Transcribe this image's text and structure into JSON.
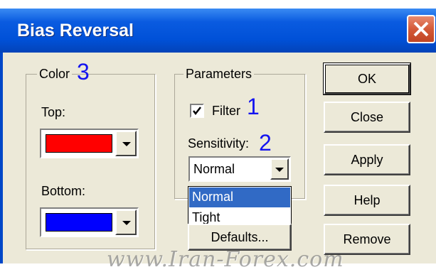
{
  "window": {
    "title": "Bias Reversal"
  },
  "color_group": {
    "legend": "Color",
    "annotation": "3",
    "top_label": "Top:",
    "top_color": "#ff0000",
    "bottom_label": "Bottom:",
    "bottom_color": "#0000ff"
  },
  "parameters_group": {
    "legend": "Parameters",
    "filter_label": "Filter",
    "filter_checked": true,
    "filter_annotation": "1",
    "sensitivity_label": "Sensitivity:",
    "sensitivity_annotation": "2",
    "sensitivity_value": "Normal",
    "sensitivity_options": [
      "Normal",
      "Tight"
    ],
    "defaults_label": "Defaults..."
  },
  "buttons": {
    "ok": "OK",
    "close": "Close",
    "apply": "Apply",
    "help": "Help",
    "remove": "Remove"
  },
  "watermark": "www.Iran-Forex.com",
  "colors": {
    "titlebar": "#0a5be0",
    "dialog_bg": "#ece9d8",
    "selection": "#316ac5",
    "annotation": "#1414f0"
  }
}
